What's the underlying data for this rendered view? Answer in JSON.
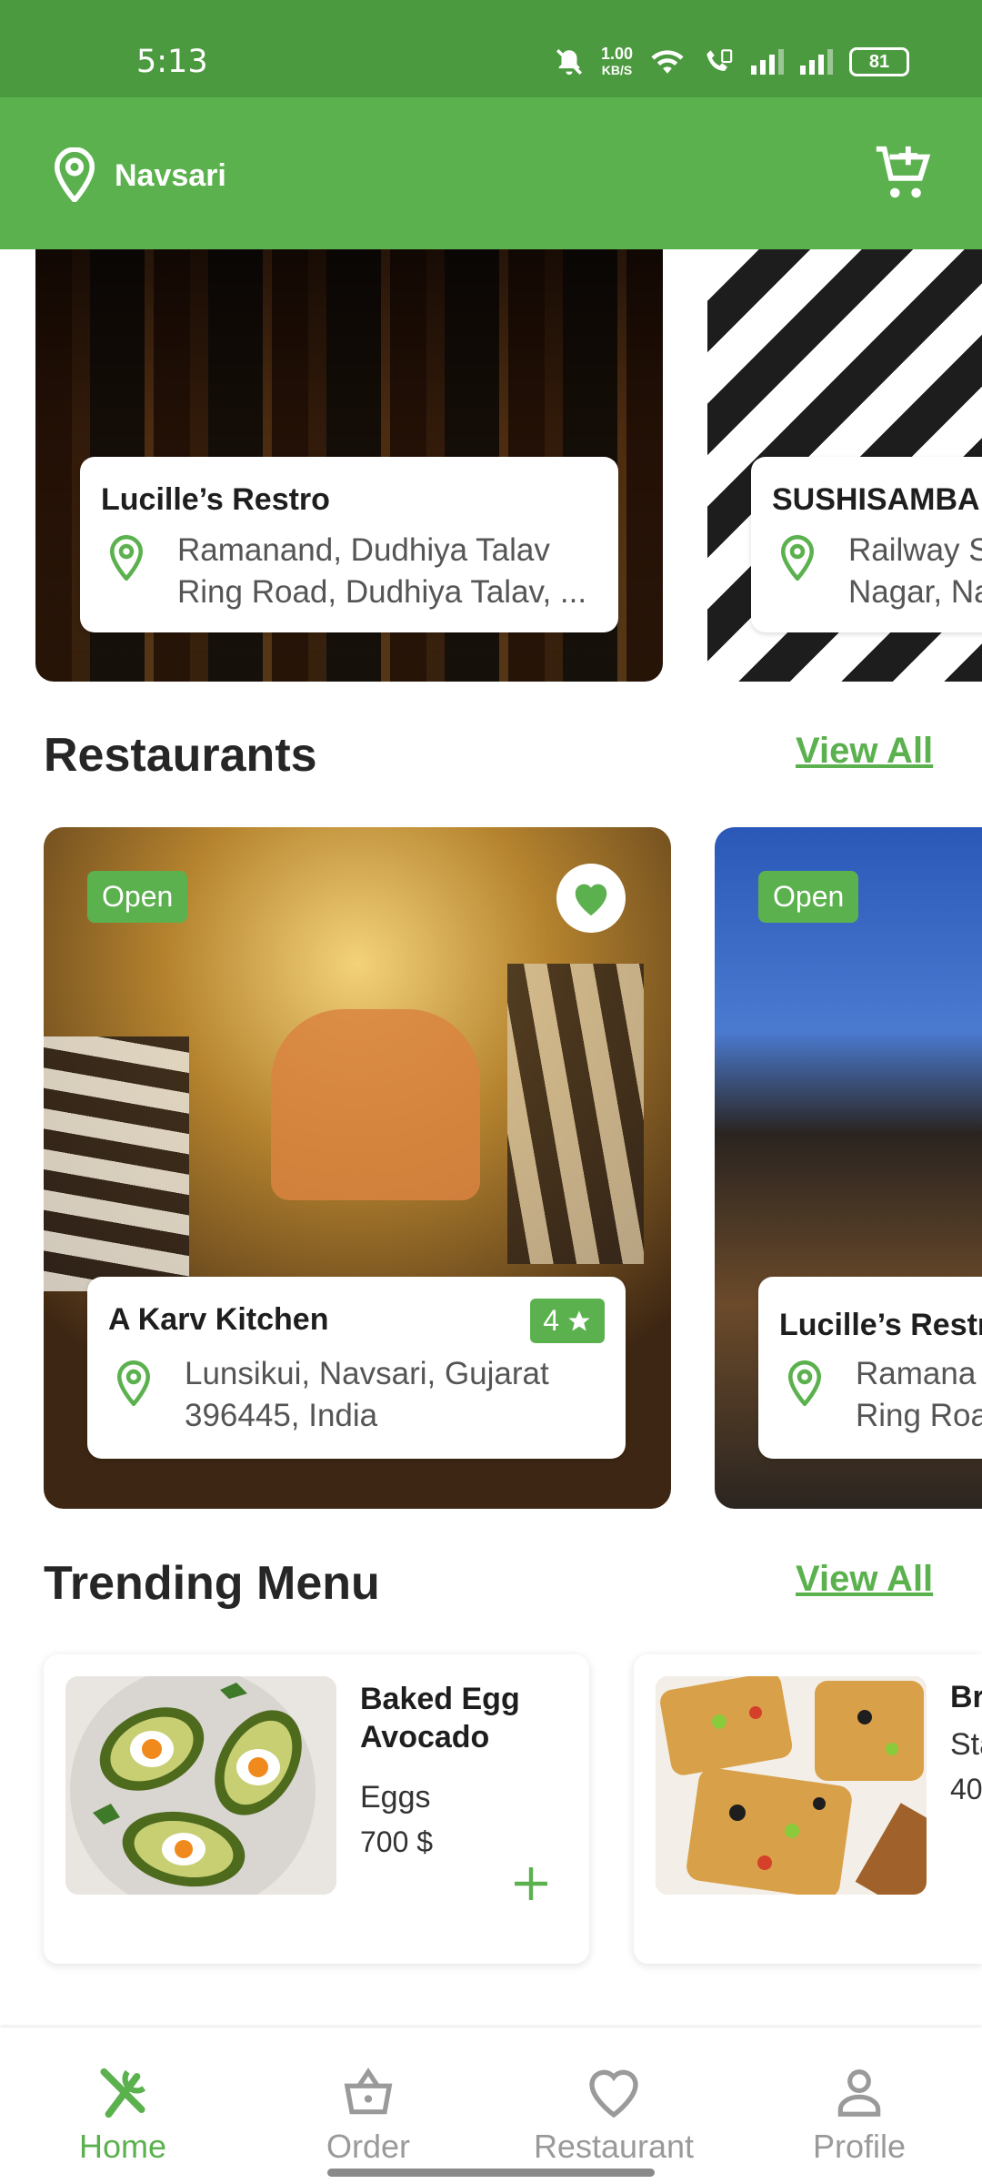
{
  "status_bar": {
    "time": "5:13",
    "speed_value": "1.00",
    "speed_unit": "KB/S",
    "battery": "81"
  },
  "app_bar": {
    "location": "Navsari",
    "icons": [
      "location-pin-icon",
      "add-to-cart-icon"
    ]
  },
  "featured": [
    {
      "name": "Lucille’s Restro",
      "address_line1": "Ramanand, Dudhiya Talav",
      "address_line2": "Ring Road, Dudhiya Talav, ..."
    },
    {
      "name": "SUSHISAMBA",
      "address_line1": "Railway S",
      "address_line2": "Nagar, Na"
    }
  ],
  "restaurants_section": {
    "title": "Restaurants",
    "view_all": "View All",
    "cards": [
      {
        "status": "Open",
        "name": "A Karv Kitchen",
        "rating": "4",
        "address_line1": "Lunsikui, Navsari, Gujarat",
        "address_line2": "396445, India",
        "favorite": true
      },
      {
        "status": "Open",
        "name": "Lucille’s Restr",
        "address_line1": "Ramana",
        "address_line2": "Ring Roa"
      }
    ]
  },
  "trending_section": {
    "title": "Trending Menu",
    "view_all": "View All",
    "items": [
      {
        "name_line1": "Baked Egg",
        "name_line2": "Avocado",
        "category": "Eggs",
        "price": "700 $"
      },
      {
        "name_line1": "Br",
        "category": "Sta",
        "price": "40"
      }
    ]
  },
  "bottom_nav": {
    "items": [
      {
        "label": "Home",
        "icon": "fork-knife-icon",
        "active": true
      },
      {
        "label": "Order",
        "icon": "basket-icon",
        "active": false
      },
      {
        "label": "Restaurant",
        "icon": "heart-icon",
        "active": false
      },
      {
        "label": "Profile",
        "icon": "person-icon",
        "active": false
      }
    ]
  },
  "colors": {
    "primary": "#5cb14f",
    "status_bar": "#4c9a3f",
    "text_dark": "#262626",
    "text_muted": "#555555",
    "nav_inactive": "#9a9a9a"
  }
}
